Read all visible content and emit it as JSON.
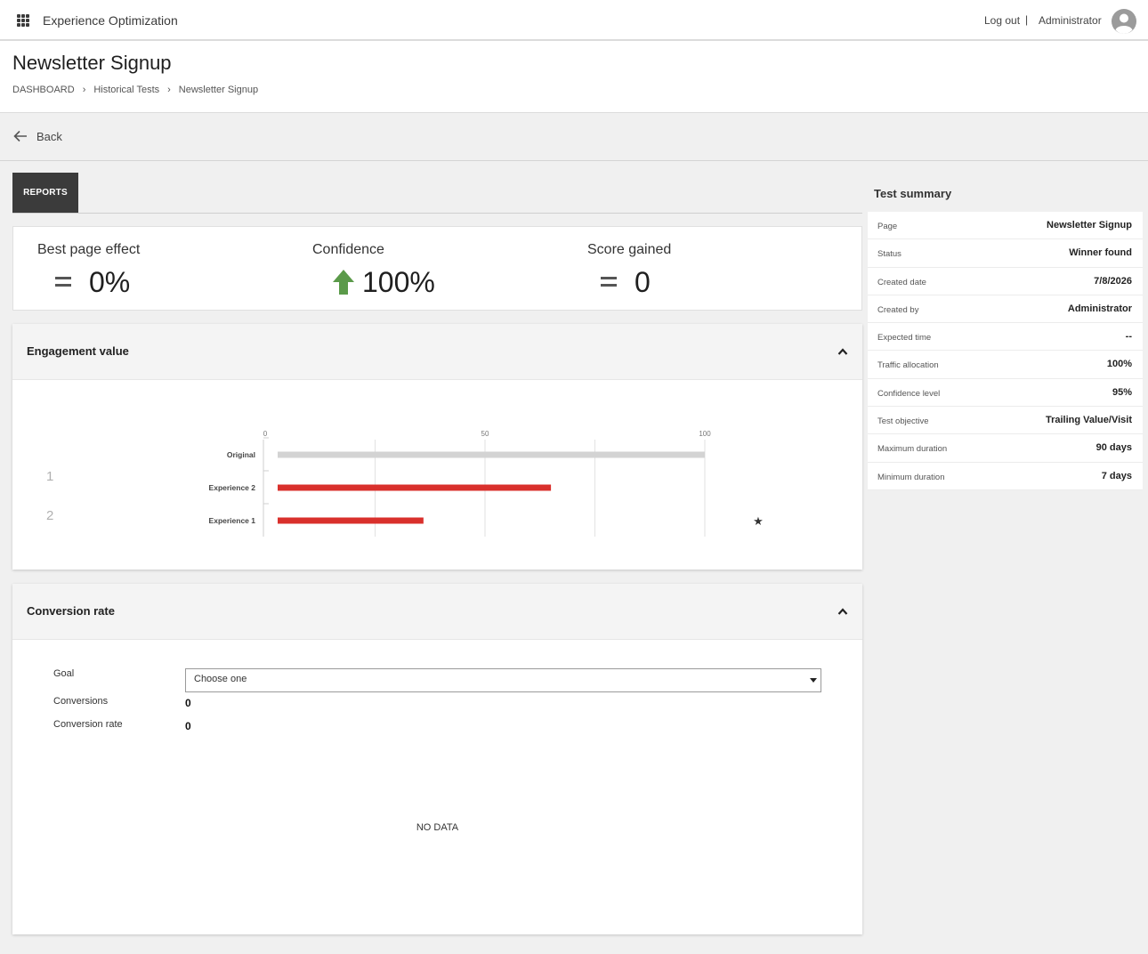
{
  "topbar": {
    "app_title": "Experience Optimization",
    "logout": "Log out",
    "separator": "|",
    "user": "Administrator"
  },
  "header": {
    "title": "Newsletter Signup",
    "breadcrumb": [
      "DASHBOARD",
      "Historical Tests",
      "Newsletter Signup"
    ]
  },
  "back_label": "Back",
  "tabs": {
    "reports": "REPORTS"
  },
  "stats": {
    "best_page_effect": {
      "label": "Best page effect",
      "value": "0%",
      "indicator": "equal"
    },
    "confidence": {
      "label": "Confidence",
      "value": "100%",
      "indicator": "up-arrow"
    },
    "score_gained": {
      "label": "Score gained",
      "value": "0",
      "indicator": "equal"
    }
  },
  "engagement": {
    "title": "Engagement value",
    "ranks": [
      "1",
      "2"
    ],
    "winner_icon": "star-icon"
  },
  "chart_data": {
    "type": "bar",
    "orientation": "horizontal",
    "categories": [
      "Original",
      "Experience 2",
      "Experience 1"
    ],
    "values": [
      100,
      65,
      36
    ],
    "colors": [
      "#d3d3d3",
      "#d9302c",
      "#d9302c"
    ],
    "x_ticks": [
      "0",
      "50",
      "100"
    ],
    "xlim": [
      0,
      100
    ],
    "grid": true
  },
  "conversion": {
    "title": "Conversion rate",
    "goal_label": "Goal",
    "goal_value": "Choose one",
    "conversions_label": "Conversions",
    "conversions_value": "0",
    "rate_label": "Conversion rate",
    "rate_value": "0",
    "no_data": "NO DATA"
  },
  "summary": {
    "title": "Test summary",
    "rows": [
      {
        "k": "Page",
        "v": "Newsletter Signup"
      },
      {
        "k": "Status",
        "v": "Winner found"
      },
      {
        "k": "Created date",
        "v": "7/8/2026"
      },
      {
        "k": "Created by",
        "v": "Administrator"
      },
      {
        "k": "Expected time",
        "v": "--"
      },
      {
        "k": "Traffic allocation",
        "v": "100%"
      },
      {
        "k": "Confidence level",
        "v": "95%"
      },
      {
        "k": "Test objective",
        "v": "Trailing Value/Visit"
      },
      {
        "k": "Maximum duration",
        "v": "90 days"
      },
      {
        "k": "Minimum duration",
        "v": "7 days"
      }
    ]
  },
  "colors": {
    "accent_bar": "#d9302c",
    "baseline_bar": "#d3d3d3",
    "confidence_arrow": "#5b9a4a",
    "tab_active": "#3b3b3b"
  }
}
